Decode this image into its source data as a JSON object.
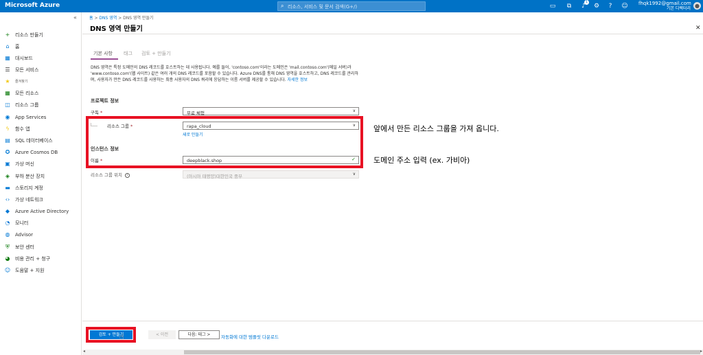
{
  "topbar": {
    "brand": "Microsoft Azure",
    "search_placeholder": "리소스, 서비스 및 문서 검색(G+/)",
    "notification_count": "1",
    "account_email": "fhqk1992@gmail.com",
    "account_directory": "기본 디렉터리",
    "icons": [
      "cloud-shell-icon",
      "directory-filter-icon",
      "bell-icon",
      "gear-icon",
      "help-icon",
      "feedback-icon"
    ]
  },
  "sidebar": {
    "items": [
      {
        "icon": "plus-icon",
        "glyph": "+",
        "color": "#107c10",
        "label": "리소스 만들기"
      },
      {
        "icon": "home-icon",
        "glyph": "⌂",
        "color": "#0078d4",
        "label": "홈"
      },
      {
        "icon": "dashboard-icon",
        "glyph": "▦",
        "color": "#0078d4",
        "label": "대시보드"
      },
      {
        "icon": "all-services-icon",
        "glyph": "☰",
        "color": "#323130",
        "label": "모든 서비스"
      },
      {
        "icon": "star-icon",
        "glyph": "★",
        "color": "#f2c811",
        "label": "즐겨찾기"
      },
      {
        "icon": "all-resources-icon",
        "glyph": "▦",
        "color": "#107c10",
        "label": "모든 리소스"
      },
      {
        "icon": "resource-group-icon",
        "glyph": "◫",
        "color": "#0078d4",
        "label": "리소스 그룹"
      },
      {
        "icon": "app-services-icon",
        "glyph": "◉",
        "color": "#0078d4",
        "label": "App Services"
      },
      {
        "icon": "function-app-icon",
        "glyph": "ϟ",
        "color": "#f2c811",
        "label": "함수 앱"
      },
      {
        "icon": "sql-database-icon",
        "glyph": "▤",
        "color": "#0078d4",
        "label": "SQL 데이터베이스"
      },
      {
        "icon": "cosmos-db-icon",
        "glyph": "✪",
        "color": "#0078d4",
        "label": "Azure Cosmos DB"
      },
      {
        "icon": "virtual-machine-icon",
        "glyph": "▣",
        "color": "#0078d4",
        "label": "가상 머신"
      },
      {
        "icon": "load-balancer-icon",
        "glyph": "◈",
        "color": "#107c10",
        "label": "부하 분산 장치"
      },
      {
        "icon": "storage-account-icon",
        "glyph": "▬",
        "color": "#0078d4",
        "label": "스토리지 계정"
      },
      {
        "icon": "virtual-network-icon",
        "glyph": "‹›",
        "color": "#0078d4",
        "label": "가상 네트워크"
      },
      {
        "icon": "active-directory-icon",
        "glyph": "◆",
        "color": "#0078d4",
        "label": "Azure Active Directory"
      },
      {
        "icon": "monitor-icon",
        "glyph": "◔",
        "color": "#0078d4",
        "label": "모니터"
      },
      {
        "icon": "advisor-icon",
        "glyph": "◍",
        "color": "#0078d4",
        "label": "Advisor"
      },
      {
        "icon": "security-center-icon",
        "glyph": "⛨",
        "color": "#107c10",
        "label": "보안 센터"
      },
      {
        "icon": "cost-management-icon",
        "glyph": "◕",
        "color": "#107c10",
        "label": "비용 관리 + 청구"
      },
      {
        "icon": "help-support-icon",
        "glyph": "☺",
        "color": "#0078d4",
        "label": "도움말 + 지원"
      }
    ]
  },
  "breadcrumb": {
    "home": "홈",
    "dns_zone": "DNS 영역",
    "current": "DNS 영역 만들기",
    "sep": ">"
  },
  "page_title": "DNS 영역 만들기",
  "tabs": [
    "기본 사항",
    "태그",
    "검토 + 만들기"
  ],
  "description": {
    "text": "DNS 영역은 특정 도메인의 DNS 레코드를 호스트하는 데 사용됩니다. 예를 들어, 'contoso.com'이라는 도메인은 'mail.contoso.com'(메일 서버)과 'www.contoso.com'(웹 사이트) 같은 여러 개의 DNS 레코드를 포함할 수 있습니다. Azure DNS를 통해 DNS 영역을 호스트하고, DNS 레코드를 관리하며, 사용자가 만든 DNS 레코드를 사용하는 최종 사용자의 DNS 쿼리에 응답하는 이름 서버를 제공할 수 있습니다.",
    "link": "자세한 정보"
  },
  "project": {
    "section": "프로젝트 정보",
    "subscription_label": "구독",
    "subscription_value": "무료 체험",
    "resource_group_label": "리소스 그룹",
    "resource_group_value": "rapa_cloud",
    "create_new": "새로 만들기"
  },
  "instance": {
    "section": "인스턴스 정보",
    "name_label": "이름",
    "name_value": "deepblack.shop",
    "location_label": "리소스 그룹 위치",
    "location_value": "(아시아 태평양)대한민국 중부"
  },
  "required_mark": "*",
  "annotations": {
    "resource_group_note": "앞에서 만든 리소스 그룹을 가져 옵니다.",
    "name_note": "도메인 주소 입력 (ex. 가비아)"
  },
  "footer": {
    "review_create": "검토 + 만들기",
    "previous": "< 이전",
    "next": "다음: 태그 >",
    "download_template": "자동화에 대한 템플릿 다운로드"
  },
  "colors": {
    "azure_blue": "#0072c6",
    "primary_button": "#0078d4",
    "annotation_red": "#e81123",
    "tab_accent": "#9b4f96"
  }
}
